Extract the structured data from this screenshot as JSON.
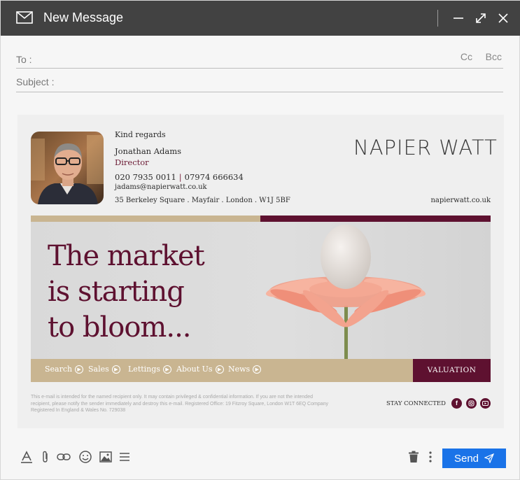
{
  "window": {
    "title": "New Message"
  },
  "fields": {
    "to_label": "To :",
    "cc_label": "Cc",
    "bcc_label": "Bcc",
    "subject_label": "Subject :"
  },
  "signature": {
    "greeting": "Kind regards",
    "name": "Jonathan Adams",
    "role": "Director",
    "phone_office": "020 7935 0011",
    "phone_separator": "|",
    "phone_mobile": "07974 666634",
    "email": "jadams@napierwatt.co.uk",
    "address": "35 Berkeley Square . Mayfair . London . W1J 5BF",
    "brand": "NAPIER WATT",
    "website": "napierwatt.co.uk"
  },
  "banner": {
    "headline_lines": [
      "The market",
      "is starting",
      "to bloom..."
    ]
  },
  "nav": {
    "items": [
      {
        "label": "Search"
      },
      {
        "label": "Sales"
      },
      {
        "label": "Lettings"
      },
      {
        "label": "About Us"
      },
      {
        "label": "News"
      }
    ],
    "valuation_label": "VALUATION"
  },
  "footer": {
    "disclaimer": "This e-mail is intended for the named recipient only. It may contain privileged & confidential information. If you are not the intended recipient, please notify the sender immediately and destroy this e-mail. Registered Office: 19 Fitzroy Square, London W1T 6EQ Company Registered In England & Wales No. 729038",
    "stay_connected": "STAY CONNECTED",
    "social_icons": [
      "facebook-icon",
      "instagram-icon",
      "youtube-icon"
    ]
  },
  "toolbar": {
    "send_label": "Send",
    "icons": [
      "text-format-icon",
      "attachment-icon",
      "link-icon",
      "emoji-icon",
      "image-icon",
      "more-options-icon",
      "trash-icon",
      "kebab-menu-icon",
      "send-icon"
    ]
  },
  "colors": {
    "titlebar": "#424242",
    "brand_wine": "#5e1130",
    "brand_tan": "#c9b591",
    "send_blue": "#1a73e8"
  }
}
